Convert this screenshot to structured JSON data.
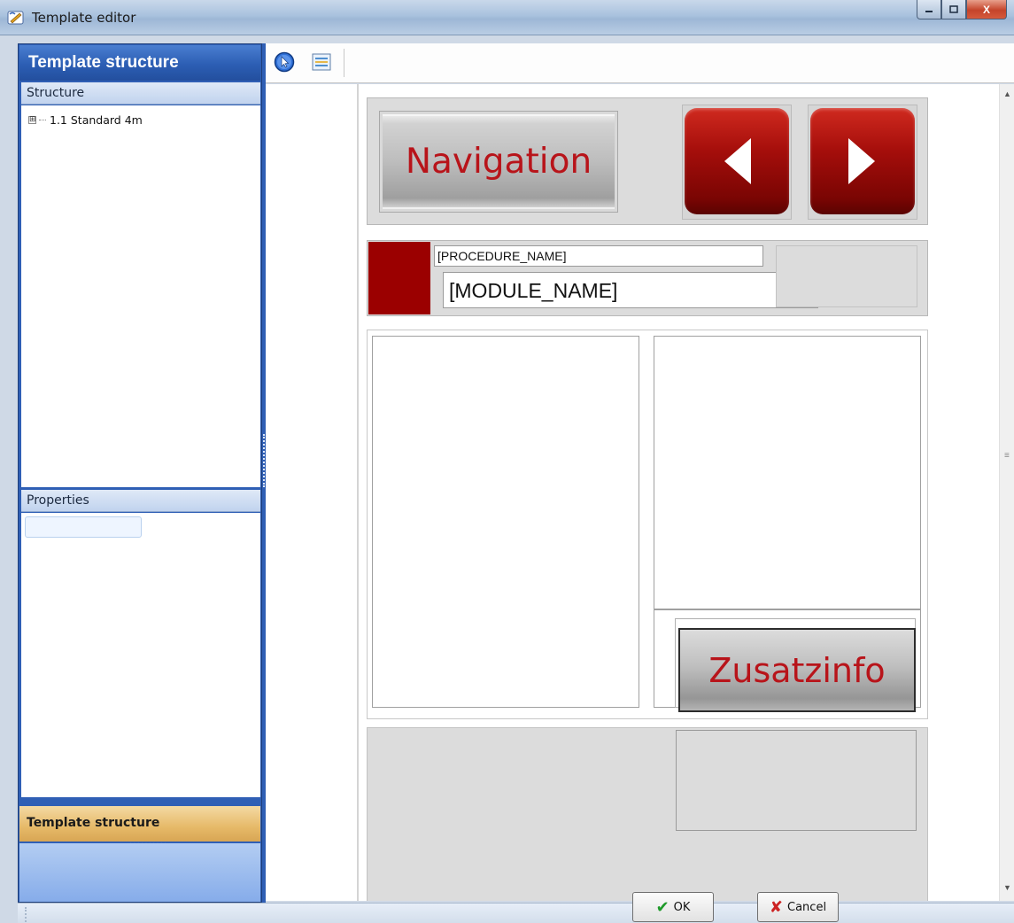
{
  "window": {
    "title": "Template editor",
    "controls": {
      "minimize": "–",
      "maximize": "□",
      "close": "X"
    }
  },
  "left_panel": {
    "header": "Template structure",
    "structure": {
      "title": "Structure",
      "tree": [
        {
          "label": "1.1 Standard 4m",
          "expander": "⊞"
        }
      ]
    },
    "properties": {
      "title": "Properties"
    },
    "footer_tab": "Template structure"
  },
  "toolbar": {
    "icons": [
      "pointer-icon",
      "list-icon"
    ]
  },
  "designer": {
    "navigation_button": "Navigation",
    "prev_button_icon": "arrow-left-icon",
    "next_button_icon": "arrow-right-icon",
    "procedure_name": "[PROCEDURE_NAME]",
    "module_name": "[MODULE_NAME]",
    "zusatzinfo_button": "Zusatzinfo",
    "accent_color": "#9b0000",
    "button_text_color": "#b8141a"
  },
  "footer": {
    "ok_label": "OK",
    "cancel_label": "Cancel"
  }
}
